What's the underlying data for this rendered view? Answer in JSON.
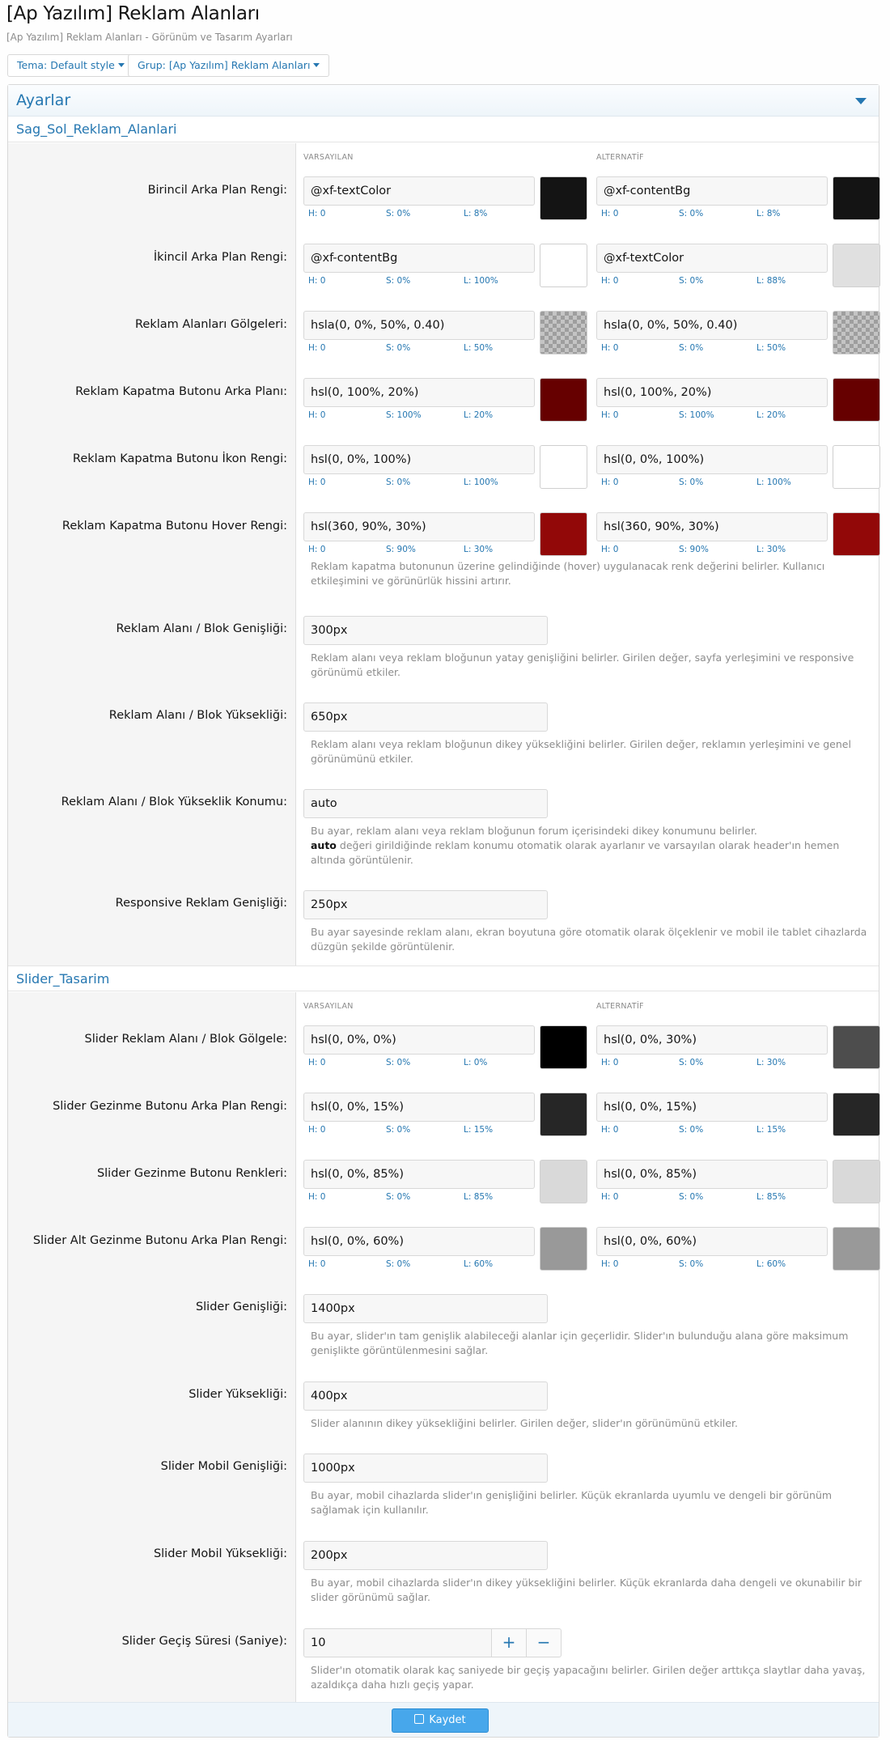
{
  "header": {
    "title": "[Ap Yazılım] Reklam Alanları",
    "description": "[Ap Yazılım] Reklam Alanları - Görünüm ve Tasarım Ayarları"
  },
  "filters": {
    "theme": "Tema: Default style",
    "group": "Grup: [Ap Yazılım] Reklam Alanları"
  },
  "block_title": "Ayarlar",
  "labels": {
    "default": "VARSAYILAN",
    "alternative": "ALTERNATİF"
  },
  "section1": {
    "title": "Sag_Sol_Reklam_Alanlari",
    "color_rows": [
      {
        "label": "Birincil Arka Plan Rengi:",
        "def": {
          "value": "@xf-textColor",
          "h": "H: 0",
          "s": "S: 0%",
          "l": "L: 8%",
          "color": "#141414"
        },
        "alt": {
          "value": "@xf-contentBg",
          "h": "H: 0",
          "s": "S: 0%",
          "l": "L: 8%",
          "color": "#141414"
        }
      },
      {
        "label": "İkincil Arka Plan Rengi:",
        "def": {
          "value": "@xf-contentBg",
          "h": "H: 0",
          "s": "S: 0%",
          "l": "L: 100%",
          "color": "#ffffff"
        },
        "alt": {
          "value": "@xf-textColor",
          "h": "H: 0",
          "s": "S: 0%",
          "l": "L: 88%",
          "color": "#e0e0e0"
        }
      },
      {
        "label": "Reklam Alanları Gölgeleri:",
        "def": {
          "value": "hsla(0, 0%, 50%, 0.40)",
          "h": "H: 0",
          "s": "S: 0%",
          "l": "L: 50%",
          "color": "checker"
        },
        "alt": {
          "value": "hsla(0, 0%, 50%, 0.40)",
          "h": "H: 0",
          "s": "S: 0%",
          "l": "L: 50%",
          "color": "checker"
        }
      },
      {
        "label": "Reklam Kapatma Butonu Arka Planı:",
        "def": {
          "value": "hsl(0, 100%, 20%)",
          "h": "H: 0",
          "s": "S: 100%",
          "l": "L: 20%",
          "color": "#660000"
        },
        "alt": {
          "value": "hsl(0, 100%, 20%)",
          "h": "H: 0",
          "s": "S: 100%",
          "l": "L: 20%",
          "color": "#660000"
        }
      },
      {
        "label": "Reklam Kapatma Butonu İkon Rengi:",
        "def": {
          "value": "hsl(0, 0%, 100%)",
          "h": "H: 0",
          "s": "S: 0%",
          "l": "L: 100%",
          "color": "#ffffff"
        },
        "alt": {
          "value": "hsl(0, 0%, 100%)",
          "h": "H: 0",
          "s": "S: 0%",
          "l": "L: 100%",
          "color": "#ffffff"
        }
      },
      {
        "label": "Reklam Kapatma Butonu Hover Rengi:",
        "def": {
          "value": "hsl(360, 90%, 30%)",
          "h": "H: 0",
          "s": "S: 90%",
          "l": "L: 30%",
          "color": "#920808"
        },
        "alt": {
          "value": "hsl(360, 90%, 30%)",
          "h": "H: 0",
          "s": "S: 90%",
          "l": "L: 30%",
          "color": "#920808"
        },
        "hint": "Reklam kapatma butonunun üzerine gelindiğinde (hover) uygulanacak renk değerini belirler. Kullanıcı etkileşimini ve görünürlük hissini artırır."
      }
    ],
    "text_rows": [
      {
        "label": "Reklam Alanı / Blok Genişliği:",
        "value": "300px",
        "hint": "Reklam alanı veya reklam bloğunun yatay genişliğini belirler. Girilen değer, sayfa yerleşimini ve responsive görünümü etkiler."
      },
      {
        "label": "Reklam Alanı / Blok Yüksekliği:",
        "value": "650px",
        "hint": "Reklam alanı veya reklam bloğunun dikey yüksekliğini belirler. Girilen değer, reklamın yerleşimini ve genel görünümünü etkiler."
      },
      {
        "label": "Reklam Alanı / Blok Yükseklik Konumu:",
        "value": "auto",
        "hint": "Bu ayar, reklam alanı veya reklam bloğunun forum içerisindeki dikey konumunu belirler.",
        "hint_bold": "auto",
        "hint_rest": " değeri girildiğinde reklam konumu otomatik olarak ayarlanır ve varsayılan olarak header'ın hemen altında görüntülenir."
      },
      {
        "label": "Responsive Reklam Genişliği:",
        "value": "250px",
        "hint": "Bu ayar sayesinde reklam alanı, ekran boyutuna göre otomatik olarak ölçeklenir ve mobil ile tablet cihazlarda düzgün şekilde görüntülenir."
      }
    ]
  },
  "section2": {
    "title": "Slider_Tasarim",
    "color_rows": [
      {
        "label": "Slider Reklam Alanı / Blok Gölgele:",
        "def": {
          "value": "hsl(0, 0%, 0%)",
          "h": "H: 0",
          "s": "S: 0%",
          "l": "L: 0%",
          "color": "#000000"
        },
        "alt": {
          "value": "hsl(0, 0%, 30%)",
          "h": "H: 0",
          "s": "S: 0%",
          "l": "L: 30%",
          "color": "#4d4d4d"
        }
      },
      {
        "label": "Slider Gezinme Butonu Arka Plan Rengi:",
        "def": {
          "value": "hsl(0, 0%, 15%)",
          "h": "H: 0",
          "s": "S: 0%",
          "l": "L: 15%",
          "color": "#262626"
        },
        "alt": {
          "value": "hsl(0, 0%, 15%)",
          "h": "H: 0",
          "s": "S: 0%",
          "l": "L: 15%",
          "color": "#262626"
        }
      },
      {
        "label": "Slider Gezinme Butonu Renkleri:",
        "def": {
          "value": "hsl(0, 0%, 85%)",
          "h": "H: 0",
          "s": "S: 0%",
          "l": "L: 85%",
          "color": "#d9d9d9"
        },
        "alt": {
          "value": "hsl(0, 0%, 85%)",
          "h": "H: 0",
          "s": "S: 0%",
          "l": "L: 85%",
          "color": "#d9d9d9"
        }
      },
      {
        "label": "Slider Alt Gezinme Butonu Arka Plan Rengi:",
        "def": {
          "value": "hsl(0, 0%, 60%)",
          "h": "H: 0",
          "s": "S: 0%",
          "l": "L: 60%",
          "color": "#999999"
        },
        "alt": {
          "value": "hsl(0, 0%, 60%)",
          "h": "H: 0",
          "s": "S: 0%",
          "l": "L: 60%",
          "color": "#999999"
        }
      }
    ],
    "text_rows": [
      {
        "label": "Slider Genişliği:",
        "value": "1400px",
        "hint": "Bu ayar, slider'ın tam genişlik alabileceği alanlar için geçerlidir. Slider'ın bulunduğu alana göre maksimum genişlikte görüntülenmesini sağlar."
      },
      {
        "label": "Slider Yüksekliği:",
        "value": "400px",
        "hint": "Slider alanının dikey yüksekliğini belirler. Girilen değer, slider'ın görünümünü etkiler."
      },
      {
        "label": "Slider Mobil Genişliği:",
        "value": "1000px",
        "hint": "Bu ayar, mobil cihazlarda slider'ın genişliğini belirler. Küçük ekranlarda uyumlu ve dengeli bir görünüm sağlamak için kullanılır."
      },
      {
        "label": "Slider Mobil Yüksekliği:",
        "value": "200px",
        "hint": "Bu ayar, mobil cihazlarda slider'ın dikey yüksekliğini belirler. Küçük ekranlarda daha dengeli ve okunabilir bir slider görünümü sağlar."
      },
      {
        "label": "Slider Geçiş Süresi (Saniye):",
        "value": "10",
        "plus": "+",
        "minus": "−",
        "hint": "Slider'ın otomatik olarak kaç saniyede bir geçiş yapacağını belirler. Girilen değer arttıkça slaytlar daha yavaş, azaldıkça daha hızlı geçiş yapar."
      }
    ]
  },
  "save_label": "Kaydet"
}
